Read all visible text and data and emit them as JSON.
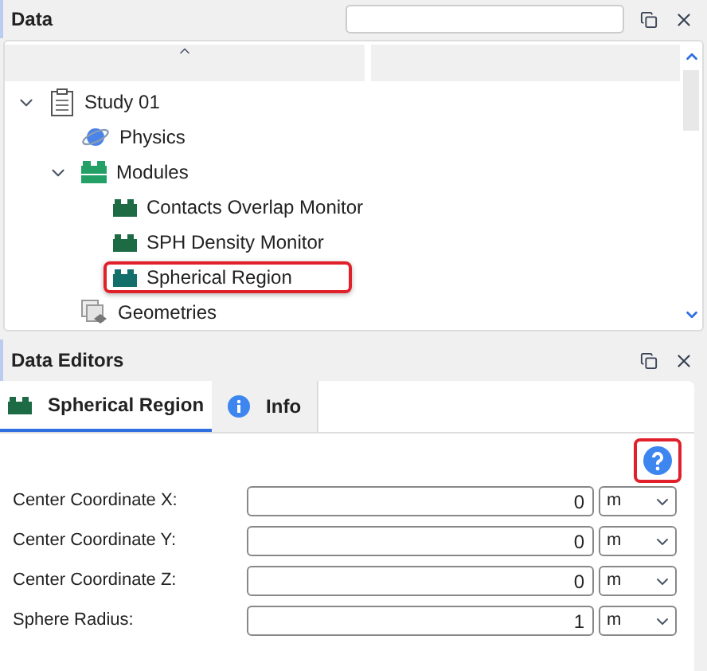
{
  "data_panel": {
    "title": "Data",
    "tree": [
      {
        "label": "Study 01",
        "kind": "study",
        "expanded": true,
        "highlighted": false,
        "children": [
          {
            "label": "Physics",
            "kind": "physics",
            "highlighted": false
          },
          {
            "label": "Modules",
            "kind": "modules",
            "expanded": true,
            "highlighted": false,
            "children": [
              {
                "label": "Contacts Overlap Monitor",
                "kind": "module",
                "highlighted": false
              },
              {
                "label": "SPH Density Monitor",
                "kind": "module",
                "highlighted": false
              },
              {
                "label": "Spherical Region",
                "kind": "module",
                "highlighted": true
              }
            ]
          },
          {
            "label": "Geometries",
            "kind": "geometries",
            "highlighted": false
          }
        ]
      }
    ]
  },
  "editors_panel": {
    "title": "Data Editors",
    "tabs": [
      {
        "label": "Spherical Region",
        "kind": "module",
        "selected": true
      },
      {
        "label": "Info",
        "kind": "info",
        "selected": false
      }
    ],
    "help_highlighted": true,
    "fields": [
      {
        "label": "Center Coordinate X:",
        "value": "0",
        "unit": "m"
      },
      {
        "label": "Center Coordinate Y:",
        "value": "0",
        "unit": "m"
      },
      {
        "label": "Center Coordinate Z:",
        "value": "0",
        "unit": "m"
      },
      {
        "label": "Sphere Radius:",
        "value": "1",
        "unit": "m"
      }
    ]
  }
}
